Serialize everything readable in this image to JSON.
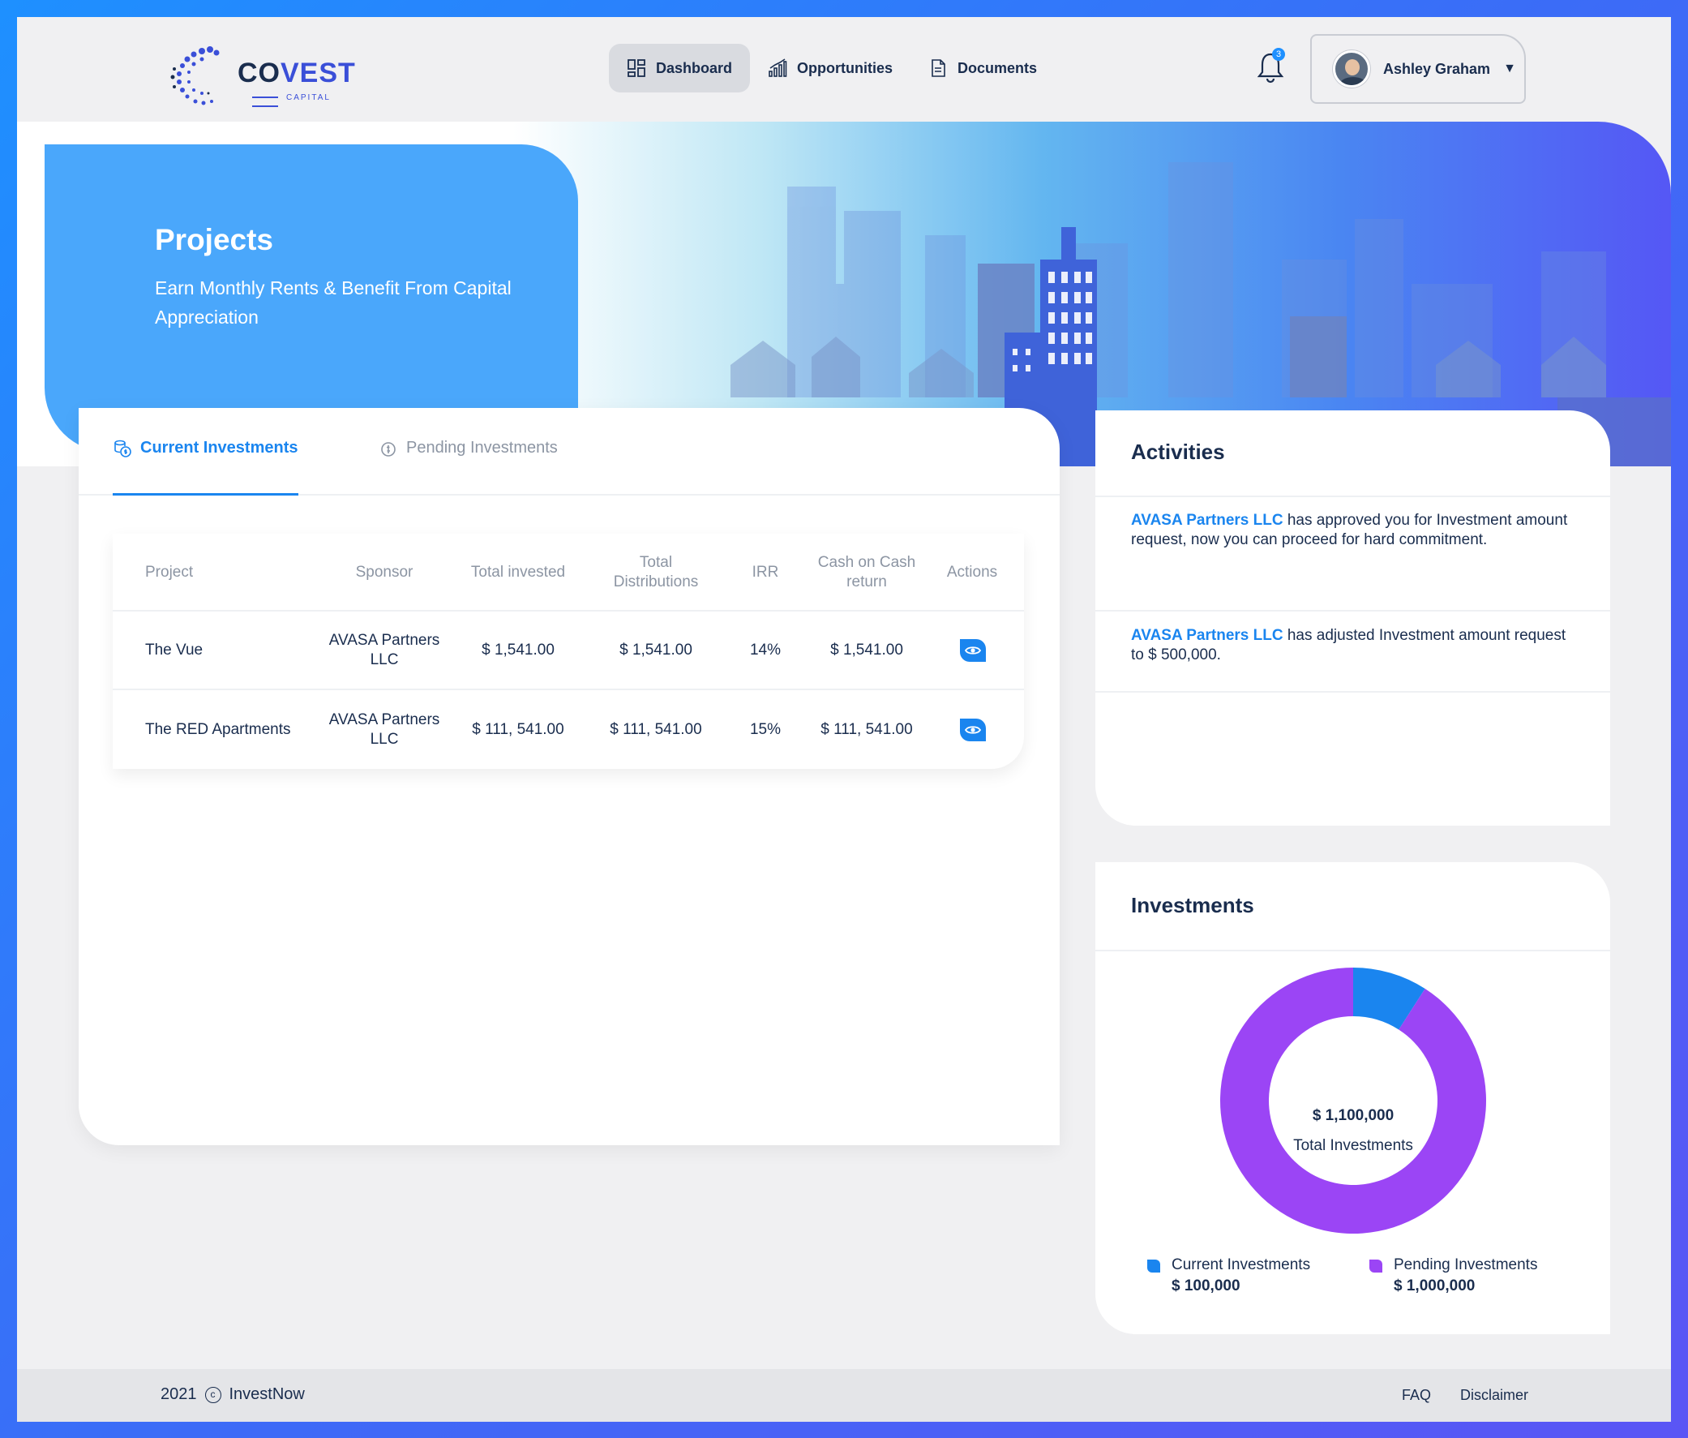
{
  "brand": {
    "logo_main_a": "CO",
    "logo_main_b": "VEST",
    "logo_sub": "CAPITAL"
  },
  "nav": [
    {
      "label": "Dashboard",
      "icon": "dashboard-icon",
      "active": true
    },
    {
      "label": "Opportunities",
      "icon": "bar-chart-icon"
    },
    {
      "label": "Documents",
      "icon": "document-icon"
    }
  ],
  "notifications": {
    "count": "3"
  },
  "user": {
    "name": "Ashley Graham"
  },
  "hero": {
    "title": "Projects",
    "subtitle": "Earn Monthly Rents & Benefit From Capital Appreciation"
  },
  "tabs": {
    "current": "Current Investments",
    "pending": "Pending Investments"
  },
  "table": {
    "headers": [
      "Project",
      "Sponsor",
      "Total invested",
      "Total Distributions",
      "IRR",
      "Cash on Cash return",
      "Actions"
    ],
    "rows": [
      {
        "project": "The Vue",
        "sponsor": "AVASA Partners LLC",
        "total_invested": "$ 1,541.00",
        "total_distributions": "$ 1,541.00",
        "irr": "14%",
        "cash_return": "$ 1,541.00"
      },
      {
        "project": "The RED Apartments",
        "sponsor": "AVASA Partners LLC",
        "total_invested": "$ 111, 541.00",
        "total_distributions": "$ 111, 541.00",
        "irr": "15%",
        "cash_return": "$ 111, 541.00"
      }
    ]
  },
  "activities": {
    "title": "Activities",
    "items": [
      {
        "actor": "AVASA Partners LLC",
        "text": " has approved you for Investment amount request, now you can proceed for hard commitment."
      },
      {
        "actor": "AVASA Partners LLC",
        "text": " has adjusted Investment amount request to $ 500,000."
      }
    ]
  },
  "investments": {
    "title": "Investments",
    "total": "$ 1,100,000",
    "total_label": "Total Investments",
    "legend": [
      {
        "name": "Current Investments",
        "value": "$ 100,000",
        "color": "#1a85ef"
      },
      {
        "name": "Pending Investments",
        "value": "$ 1,000,000",
        "color": "#9b45f5"
      }
    ]
  },
  "chart_data": {
    "type": "pie",
    "categories": [
      "Current Investments",
      "Pending Investments"
    ],
    "values": [
      100000,
      1000000
    ],
    "colors": [
      "#1a85ef",
      "#9b45f5"
    ]
  },
  "footer": {
    "year": "2021",
    "copyright_symbol": "c",
    "brand": "InvestNow",
    "links": [
      "FAQ",
      "Disclaimer"
    ]
  }
}
